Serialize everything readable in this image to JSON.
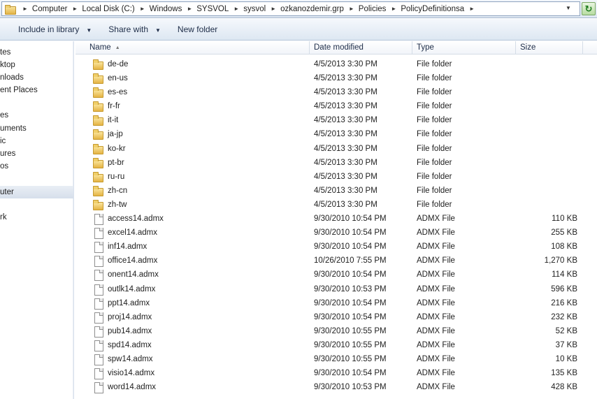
{
  "address_bar": {
    "breadcrumbs": [
      "Computer",
      "Local Disk (C:)",
      "Windows",
      "SYSVOL",
      "sysvol",
      "ozkanozdemir.grp",
      "Policies",
      "PolicyDefinitionsa"
    ],
    "refresh_glyph": "↻"
  },
  "toolbar": {
    "include_in_library": "Include in library",
    "share_with": "Share with",
    "new_folder": "New folder"
  },
  "nav_pane": {
    "items": [
      "tes",
      "ktop",
      "nloads",
      "ent Places",
      "es",
      "uments",
      "ic",
      "ures",
      "os",
      "uter",
      "rk"
    ],
    "selected": "uter"
  },
  "columns": {
    "name": "Name",
    "date_modified": "Date modified",
    "type": "Type",
    "size": "Size"
  },
  "files": [
    {
      "name": "de-de",
      "date": "4/5/2013 3:30 PM",
      "type": "File folder",
      "size": "",
      "icon": "folder-icon"
    },
    {
      "name": "en-us",
      "date": "4/5/2013 3:30 PM",
      "type": "File folder",
      "size": "",
      "icon": "folder-icon"
    },
    {
      "name": "es-es",
      "date": "4/5/2013 3:30 PM",
      "type": "File folder",
      "size": "",
      "icon": "folder-icon"
    },
    {
      "name": "fr-fr",
      "date": "4/5/2013 3:30 PM",
      "type": "File folder",
      "size": "",
      "icon": "folder-icon"
    },
    {
      "name": "it-it",
      "date": "4/5/2013 3:30 PM",
      "type": "File folder",
      "size": "",
      "icon": "folder-icon"
    },
    {
      "name": "ja-jp",
      "date": "4/5/2013 3:30 PM",
      "type": "File folder",
      "size": "",
      "icon": "folder-icon"
    },
    {
      "name": "ko-kr",
      "date": "4/5/2013 3:30 PM",
      "type": "File folder",
      "size": "",
      "icon": "folder-icon"
    },
    {
      "name": "pt-br",
      "date": "4/5/2013 3:30 PM",
      "type": "File folder",
      "size": "",
      "icon": "folder-icon"
    },
    {
      "name": "ru-ru",
      "date": "4/5/2013 3:30 PM",
      "type": "File folder",
      "size": "",
      "icon": "folder-icon"
    },
    {
      "name": "zh-cn",
      "date": "4/5/2013 3:30 PM",
      "type": "File folder",
      "size": "",
      "icon": "folder-icon"
    },
    {
      "name": "zh-tw",
      "date": "4/5/2013 3:30 PM",
      "type": "File folder",
      "size": "",
      "icon": "folder-icon"
    },
    {
      "name": "access14.admx",
      "date": "9/30/2010 10:54 PM",
      "type": "ADMX File",
      "size": "110 KB",
      "icon": "file-icon"
    },
    {
      "name": "excel14.admx",
      "date": "9/30/2010 10:54 PM",
      "type": "ADMX File",
      "size": "255 KB",
      "icon": "file-icon"
    },
    {
      "name": "inf14.admx",
      "date": "9/30/2010 10:54 PM",
      "type": "ADMX File",
      "size": "108 KB",
      "icon": "file-icon"
    },
    {
      "name": "office14.admx",
      "date": "10/26/2010 7:55 PM",
      "type": "ADMX File",
      "size": "1,270 KB",
      "icon": "file-icon"
    },
    {
      "name": "onent14.admx",
      "date": "9/30/2010 10:54 PM",
      "type": "ADMX File",
      "size": "114 KB",
      "icon": "file-icon"
    },
    {
      "name": "outlk14.admx",
      "date": "9/30/2010 10:53 PM",
      "type": "ADMX File",
      "size": "596 KB",
      "icon": "file-icon"
    },
    {
      "name": "ppt14.admx",
      "date": "9/30/2010 10:54 PM",
      "type": "ADMX File",
      "size": "216 KB",
      "icon": "file-icon"
    },
    {
      "name": "proj14.admx",
      "date": "9/30/2010 10:54 PM",
      "type": "ADMX File",
      "size": "232 KB",
      "icon": "file-icon"
    },
    {
      "name": "pub14.admx",
      "date": "9/30/2010 10:55 PM",
      "type": "ADMX File",
      "size": "52 KB",
      "icon": "file-icon"
    },
    {
      "name": "spd14.admx",
      "date": "9/30/2010 10:55 PM",
      "type": "ADMX File",
      "size": "37 KB",
      "icon": "file-icon"
    },
    {
      "name": "spw14.admx",
      "date": "9/30/2010 10:55 PM",
      "type": "ADMX File",
      "size": "10 KB",
      "icon": "file-icon"
    },
    {
      "name": "visio14.admx",
      "date": "9/30/2010 10:54 PM",
      "type": "ADMX File",
      "size": "135 KB",
      "icon": "file-icon"
    },
    {
      "name": "word14.admx",
      "date": "9/30/2010 10:53 PM",
      "type": "ADMX File",
      "size": "428 KB",
      "icon": "file-icon"
    }
  ]
}
